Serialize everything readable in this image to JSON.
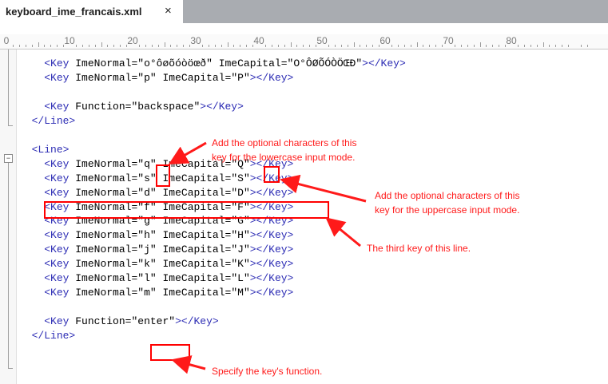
{
  "tab": {
    "title": "keyboard_ime_francais.xml",
    "close_glyph": "×"
  },
  "ruler": {
    "labels": [
      "0",
      "10",
      "20",
      "30",
      "40",
      "50",
      "60",
      "70",
      "80"
    ]
  },
  "code": {
    "lines": [
      {
        "k": "key",
        "indent": "    ",
        "normal": "o°ôøõóòöœð",
        "capital": "O°ÔØÕÓÒÖŒÐ"
      },
      {
        "k": "key",
        "indent": "    ",
        "normal": "p",
        "capital": "P"
      },
      {
        "k": "blank"
      },
      {
        "k": "func",
        "indent": "    ",
        "name": "backspace"
      },
      {
        "k": "close",
        "indent": "  "
      },
      {
        "k": "blank"
      },
      {
        "k": "open",
        "indent": "  "
      },
      {
        "k": "key",
        "indent": "    ",
        "normal": "q",
        "capital": "Q"
      },
      {
        "k": "key",
        "indent": "    ",
        "normal": "s",
        "capital": "S"
      },
      {
        "k": "key",
        "indent": "    ",
        "normal": "d",
        "capital": "D"
      },
      {
        "k": "key",
        "indent": "    ",
        "normal": "f",
        "capital": "F"
      },
      {
        "k": "key",
        "indent": "    ",
        "normal": "g",
        "capital": "G"
      },
      {
        "k": "key",
        "indent": "    ",
        "normal": "h",
        "capital": "H"
      },
      {
        "k": "key",
        "indent": "    ",
        "normal": "j",
        "capital": "J"
      },
      {
        "k": "key",
        "indent": "    ",
        "normal": "k",
        "capital": "K"
      },
      {
        "k": "key",
        "indent": "    ",
        "normal": "l",
        "capital": "L"
      },
      {
        "k": "key",
        "indent": "    ",
        "normal": "m",
        "capital": "M"
      },
      {
        "k": "blank"
      },
      {
        "k": "func",
        "indent": "    ",
        "name": "enter"
      },
      {
        "k": "close",
        "indent": "  "
      }
    ]
  },
  "annotations": {
    "lowercase": [
      "Add the optional characters of this",
      "key for the lowercase input mode."
    ],
    "uppercase": [
      "Add the optional characters of this",
      "key for the uppercase input mode."
    ],
    "third_key": "The third key of this line.",
    "function": "Specify the key's function."
  },
  "colors": {
    "annotation": "#ff1a1a",
    "tag": "#2c2cb4",
    "tabbar": "#a9acb1"
  }
}
